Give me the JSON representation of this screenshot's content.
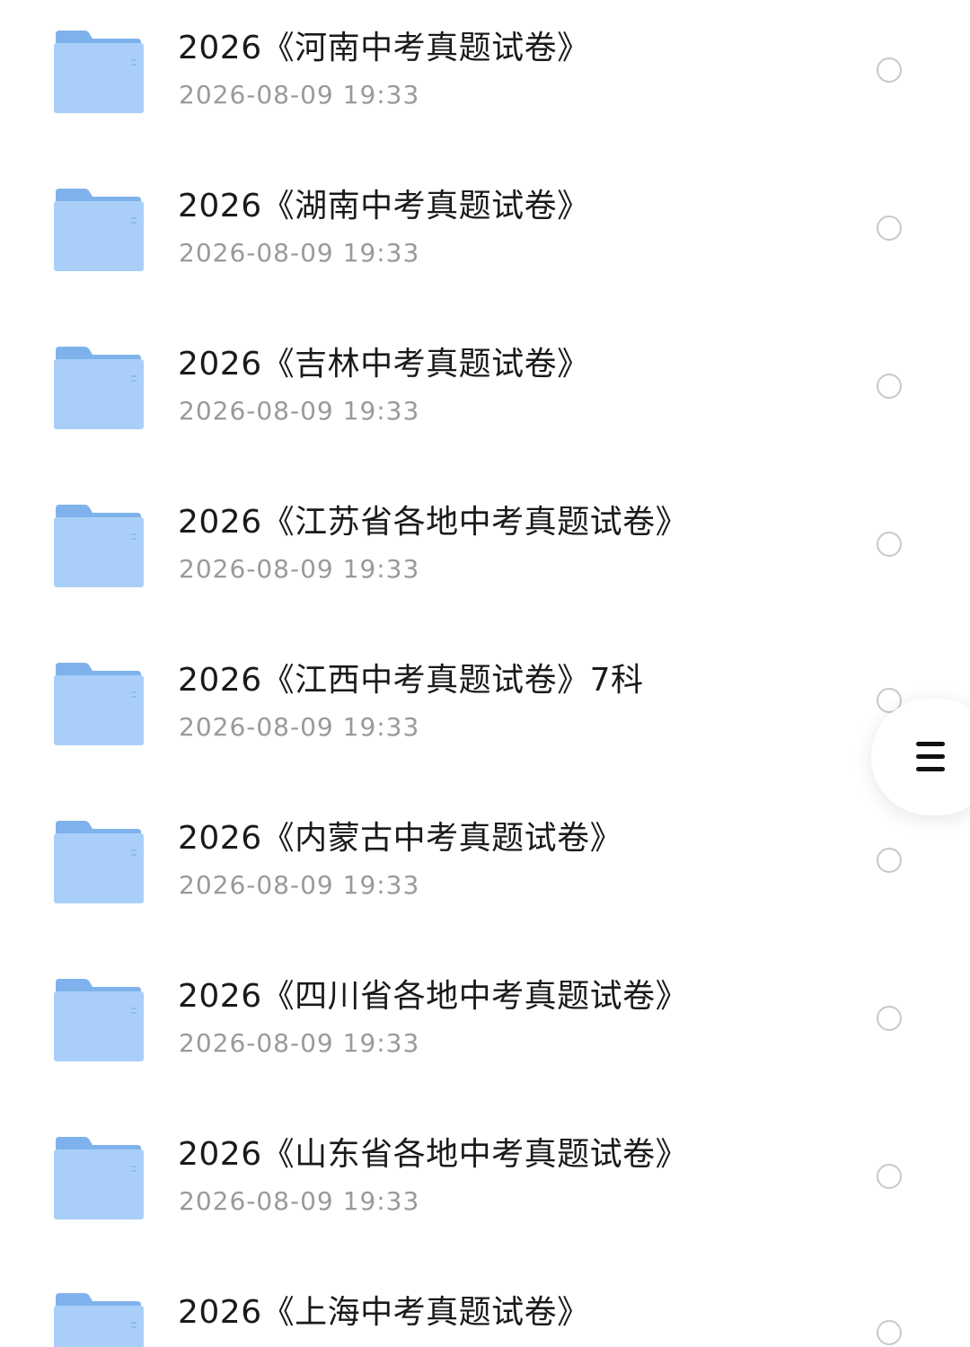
{
  "colors": {
    "title": "#1a1a1a",
    "meta": "#9a9a9a",
    "folder_back": "#7fb2ec",
    "folder_front": "#a9cff8",
    "radio_border": "#c8c8c8"
  },
  "files": [
    {
      "name": "2026《河南中考真题试卷》",
      "time": "2026-08-09 19:33",
      "icon": "folder-icon"
    },
    {
      "name": "2026《湖南中考真题试卷》",
      "time": "2026-08-09 19:33",
      "icon": "folder-icon"
    },
    {
      "name": "2026《吉林中考真题试卷》",
      "time": "2026-08-09 19:33",
      "icon": "folder-icon"
    },
    {
      "name": "2026《江苏省各地中考真题试卷》",
      "time": "2026-08-09 19:33",
      "icon": "folder-icon"
    },
    {
      "name": "2026《江西中考真题试卷》7科",
      "time": "2026-08-09 19:33",
      "icon": "folder-icon"
    },
    {
      "name": "2026《内蒙古中考真题试卷》",
      "time": "2026-08-09 19:33",
      "icon": "folder-icon"
    },
    {
      "name": "2026《四川省各地中考真题试卷》",
      "time": "2026-08-09 19:33",
      "icon": "folder-icon"
    },
    {
      "name": "2026《山东省各地中考真题试卷》",
      "time": "2026-08-09 19:33",
      "icon": "folder-icon"
    },
    {
      "name": "2026《上海中考真题试卷》",
      "time": "",
      "icon": "folder-icon"
    }
  ],
  "floating_button": {
    "icon": "menu-icon"
  }
}
